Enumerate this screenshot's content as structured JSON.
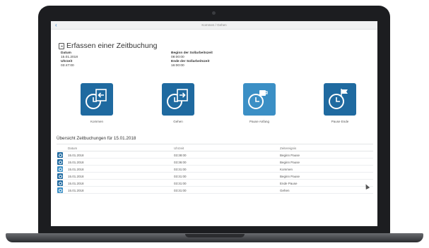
{
  "nav": {
    "back_glyph": "‹",
    "title": "Kommen / Gehen"
  },
  "page": {
    "title": "Erfassen einer Zeitbuchung",
    "date_label": "Datum",
    "date_value": "15.01.2018",
    "time_label": "Uhrzeit",
    "time_value": "03:47:00",
    "work_start_label": "Beginn der Sollarbeitszeit",
    "work_start_value": "08:00:00",
    "work_end_label": "Ende der Sollarbeitszeit",
    "work_end_value": "16:00:00"
  },
  "tiles": [
    {
      "label": "Kommen",
      "icon": "clock-arrow-in-icon"
    },
    {
      "label": "Gehen",
      "icon": "clock-arrow-out-icon"
    },
    {
      "label": "Pause Anfang",
      "icon": "clock-coffee-icon"
    },
    {
      "label": "Pause Ende",
      "icon": "clock-flag-icon"
    }
  ],
  "overview": {
    "title": "Übersicht Zeitbuchungen für 15.01.2018",
    "columns": [
      "Datum",
      "Uhrzeit",
      "Zeitereignis"
    ],
    "rows": [
      [
        "15.01.2018",
        "03:38:00",
        "Beginn Pause"
      ],
      [
        "15.01.2018",
        "03:36:00",
        "Beginn Pause"
      ],
      [
        "15.01.2018",
        "03:31:00",
        "Kommen"
      ],
      [
        "15.01.2018",
        "03:31:00",
        "Beginn Pause"
      ],
      [
        "15.01.2018",
        "03:31:00",
        "Ende Pause"
      ],
      [
        "15.01.2018",
        "03:31:00",
        "Gehen"
      ]
    ]
  },
  "colors": {
    "tile_dark": "#1f6aa0",
    "tile_light": "#3b8fc5",
    "link": "#3a83c4"
  }
}
